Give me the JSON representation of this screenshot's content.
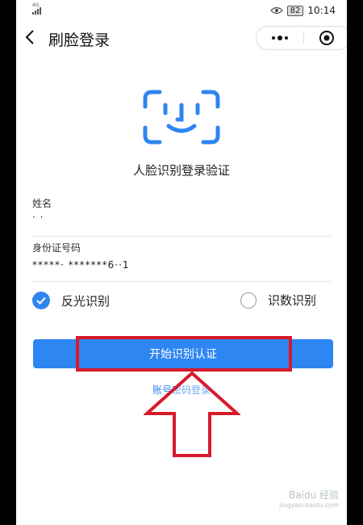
{
  "status_bar": {
    "network": "4G",
    "battery": "82",
    "time": "10:14"
  },
  "nav": {
    "back_icon": "chevron-left-icon",
    "title": "刷脸登录",
    "more_icon": "more-dots-icon",
    "close_icon": "target-icon"
  },
  "face": {
    "icon": "face-scan-icon",
    "caption": "人脸识别登录验证"
  },
  "form": {
    "name_label": "姓名",
    "name_value": "·   ·",
    "id_label": "身份证号码",
    "id_value": "*****·  *******6··1"
  },
  "options": {
    "reflect": {
      "label": "反光识别",
      "selected": true
    },
    "digits": {
      "label": "识数识别",
      "selected": false
    }
  },
  "start_button": "开始识别认证",
  "account_link": "账号密码登录",
  "colors": {
    "accent": "#2e86f3",
    "highlight": "#d8192d"
  },
  "watermark": {
    "main": "Baidu 经验",
    "sub": "jingyan.baidu.com"
  }
}
